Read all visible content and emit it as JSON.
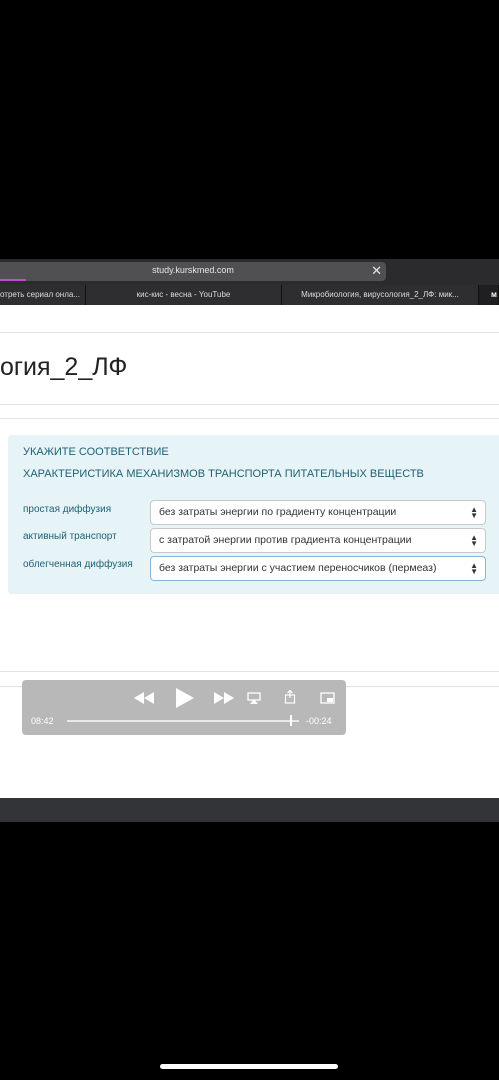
{
  "browser": {
    "url": "study.kurskmed.com",
    "tabs": [
      {
        "label": "отреть сериал онла..."
      },
      {
        "label": "кис-кис - весна - YouTube"
      },
      {
        "label": "Микробиология, вирусология_2_ЛФ: мик..."
      },
      {
        "label": "м"
      }
    ]
  },
  "page": {
    "title": "огия_2_ЛФ",
    "question": {
      "instruction": "УКАЖИТЕ СООТВЕТСТВИЕ",
      "topic": "ХАРАКТЕРИСТИКА МЕХАНИЗМОВ ТРАНСПОРТА ПИТАТЕЛЬНЫХ ВЕЩЕСТВ",
      "rows": [
        {
          "label": "простая диффузия",
          "selected": "без затраты энергии по градиенту концентрации"
        },
        {
          "label": "активный транспорт",
          "selected": "с затратой энергии против градиента концентрации"
        },
        {
          "label": "облегченная диффузия",
          "selected": "без затраты энергии с участием переносчиков (пермеаз)"
        }
      ]
    }
  },
  "video": {
    "elapsed": "08:42",
    "remaining": "-00:24",
    "progress": 0.96
  },
  "colors": {
    "question_bg": "#e6f4f7",
    "question_text": "#1f5f75",
    "progress_accent": "#c04dd0"
  }
}
